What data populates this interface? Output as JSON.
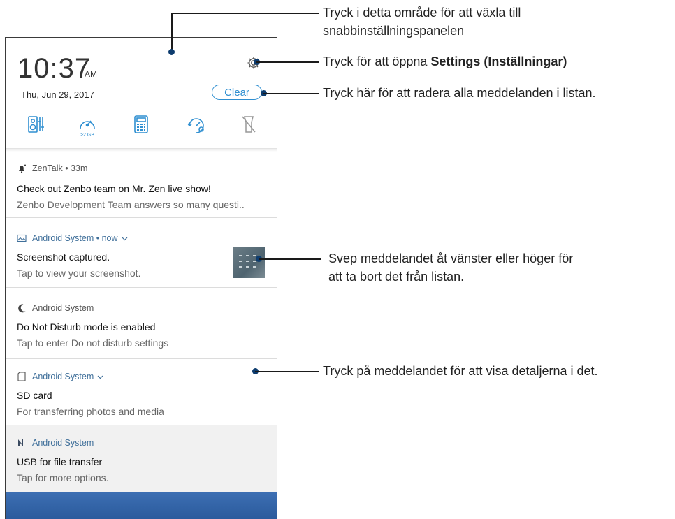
{
  "status": {
    "time": "10:37",
    "ampm": "AM",
    "date": "Thu, Jun 29, 2017",
    "clear_label": "Clear",
    "storage_label": ">2 GB"
  },
  "quick_settings": [
    {
      "name": "audio-wizard-icon"
    },
    {
      "name": "boost-icon"
    },
    {
      "name": "calculator-icon"
    },
    {
      "name": "auto-start-icon"
    },
    {
      "name": "flashlight-off-icon"
    }
  ],
  "notifications": [
    {
      "app": "ZenTalk",
      "time": "33m",
      "title": "Check out Zenbo team on Mr. Zen live show!",
      "text": "Zenbo Development Team answers so many questi.."
    },
    {
      "app": "Android System",
      "time": "now",
      "title": "Screenshot captured.",
      "text": "Tap to view your screenshot."
    },
    {
      "app": "Android System",
      "title": "Do Not Disturb mode is enabled",
      "text": "Tap to enter Do not disturb settings"
    },
    {
      "app": "Android System",
      "title": "SD card",
      "text": "For transferring photos and media"
    },
    {
      "app": "Android System",
      "title": "USB for file transfer",
      "text": "Tap for more options."
    }
  ],
  "callouts": {
    "quick_panel_1": "Tryck i detta område för att växla till",
    "quick_panel_2": "snabbinställningspanelen",
    "settings_prefix": "Tryck för att öppna ",
    "settings_bold": "Settings (Inställningar)",
    "clear": "Tryck här för att radera alla meddelanden i listan.",
    "swipe_1": "Svep meddelandet åt vänster eller höger för",
    "swipe_2": "att ta bort det från listan.",
    "details": "Tryck på meddelandet för att visa detaljerna i det."
  },
  "colors": {
    "accent": "#2f8fd1",
    "callout_dot": "#0d3c6e",
    "wallpaper": "#3d6fb3"
  }
}
